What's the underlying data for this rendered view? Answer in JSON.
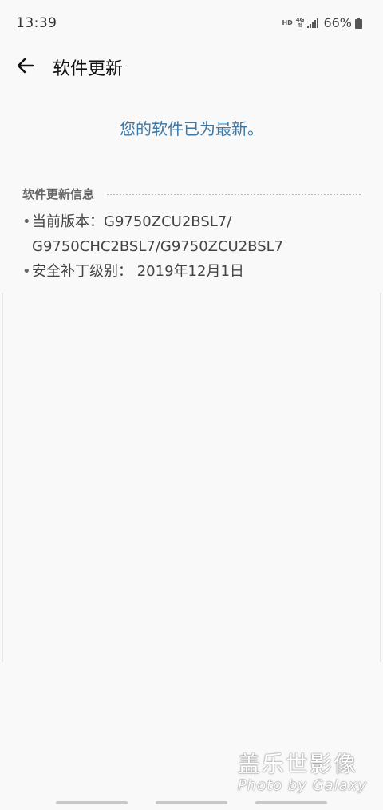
{
  "status_bar": {
    "time": "13:39",
    "hd": "HD",
    "network": "4G",
    "battery_percent": "66%"
  },
  "header": {
    "title": "软件更新",
    "back_icon": "arrow-left-icon"
  },
  "status_message": "您的软件已为最新。",
  "info": {
    "heading": "软件更新信息",
    "current_version_label": "当前版本：",
    "current_version_line1": "G9750ZCU2BSL7/",
    "current_version_line2": "G9750CHC2BSL7/G9750ZCU2BSL7",
    "security_patch_label": "安全补丁级别：",
    "security_patch_value": "2019年12月1日"
  },
  "watermark": {
    "main": "盖乐世影像",
    "sub": "Photo by Galaxy"
  },
  "colors": {
    "accent": "#3e78a6",
    "background": "#f9f9f9"
  }
}
